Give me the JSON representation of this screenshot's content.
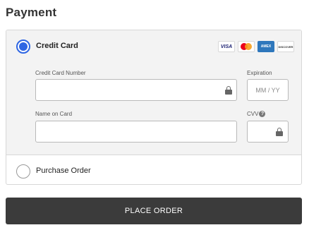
{
  "page": {
    "title": "Payment"
  },
  "payment_methods": {
    "credit_card": {
      "label": "Credit Card",
      "selected": true,
      "card_brands": [
        {
          "name": "VISA",
          "icon": "visa-icon"
        },
        {
          "name": "Mastercard",
          "icon": "mastercard-icon"
        },
        {
          "name": "AMEX",
          "icon": "amex-icon"
        },
        {
          "name": "DISCOVER",
          "icon": "discover-icon"
        }
      ],
      "fields": {
        "card_number": {
          "label": "Credit Card Number",
          "value": "",
          "placeholder": ""
        },
        "expiration": {
          "label": "Expiration",
          "value": "",
          "placeholder": "MM / YY"
        },
        "name_on_card": {
          "label": "Name on Card",
          "value": "",
          "placeholder": ""
        },
        "cvv": {
          "label": "CVV",
          "value": "",
          "placeholder": ""
        }
      }
    },
    "purchase_order": {
      "label": "Purchase Order",
      "selected": false
    }
  },
  "actions": {
    "place_order_label": "PLACE ORDER"
  },
  "colors": {
    "accent": "#2f66e3",
    "button_bg": "#3b3b3b",
    "section_bg": "#f3f3f3"
  }
}
